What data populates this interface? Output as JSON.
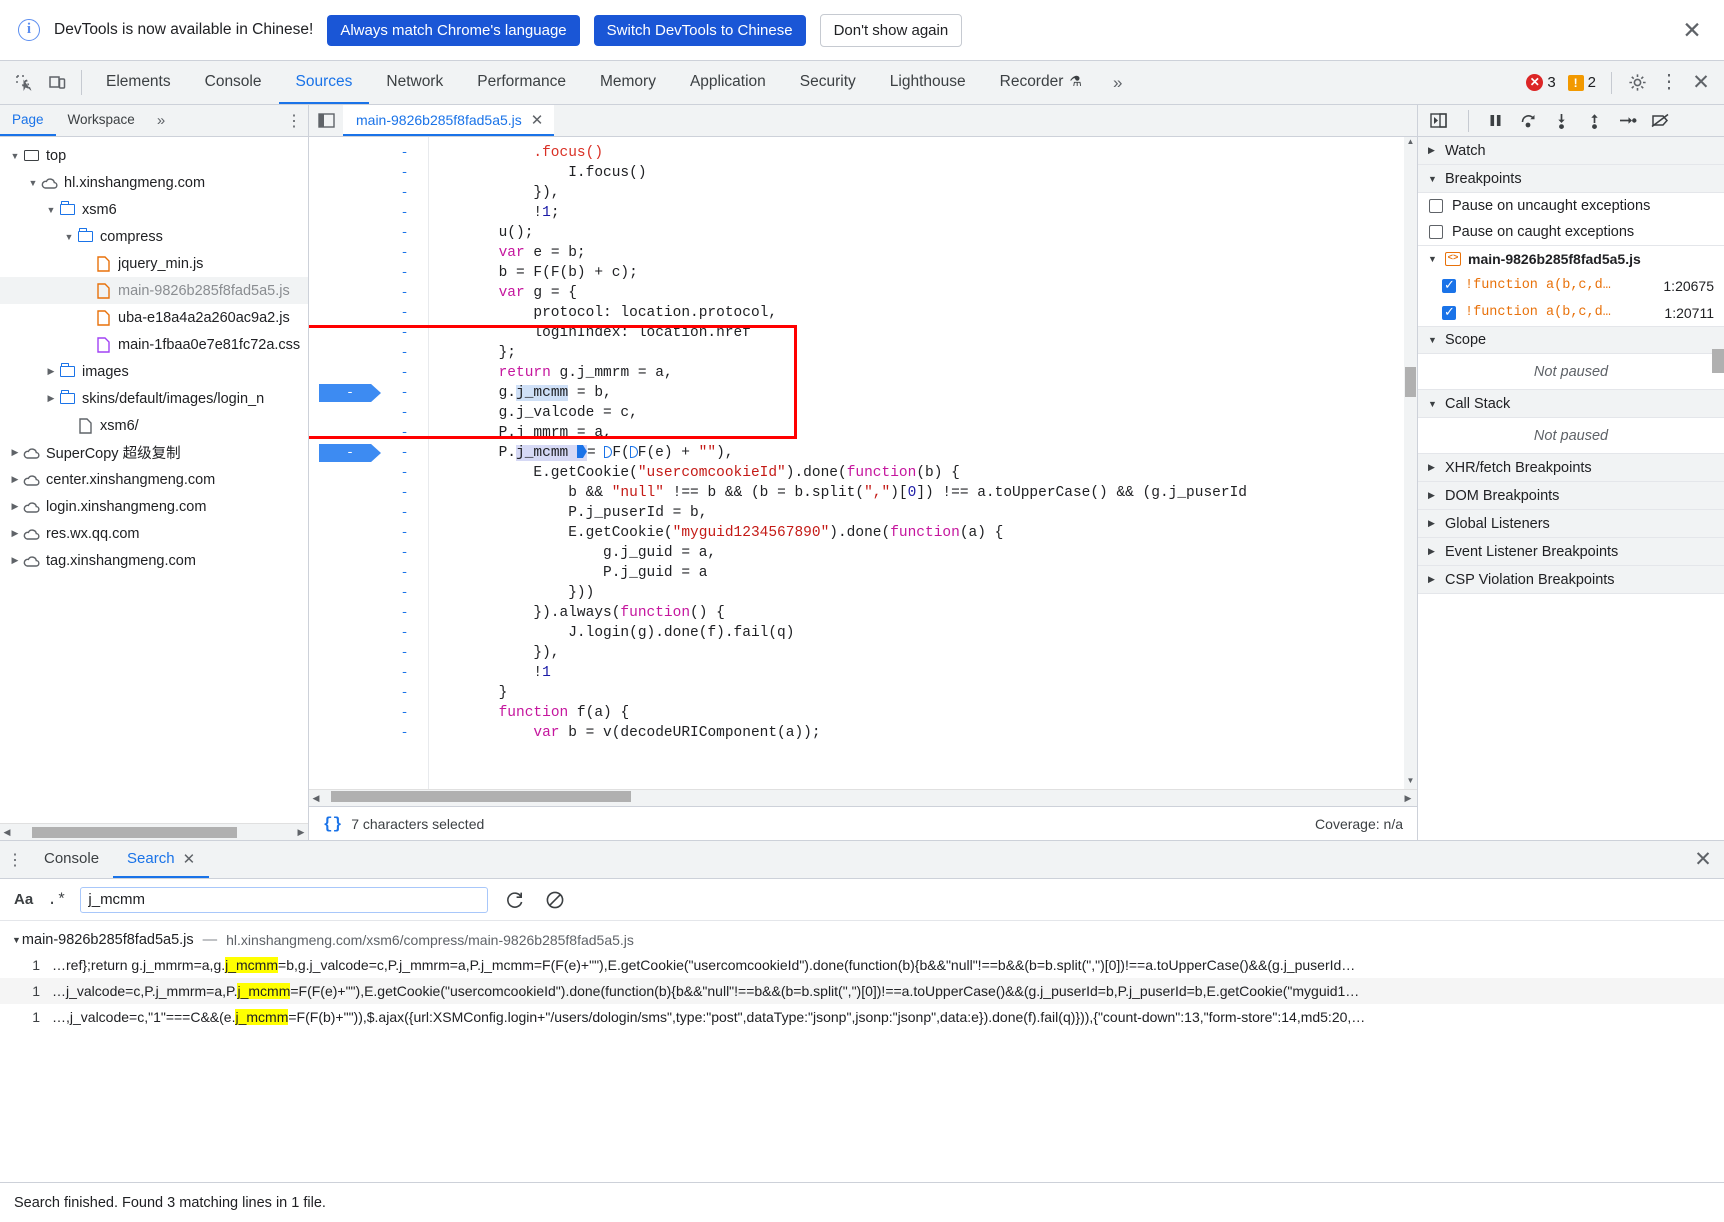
{
  "infobar": {
    "icon": "info-circle-icon",
    "message": "DevTools is now available in Chinese!",
    "primary_button": "Always match Chrome's language",
    "secondary_button": "Switch DevTools to Chinese",
    "tertiary_button": "Don't show again",
    "close_icon": "✕"
  },
  "main_tabs": {
    "inspect_icon": "inspect-element-icon",
    "device_icon": "device-toolbar-icon",
    "items": [
      {
        "label": "Elements",
        "active": false
      },
      {
        "label": "Console",
        "active": false
      },
      {
        "label": "Sources",
        "active": true
      },
      {
        "label": "Network",
        "active": false
      },
      {
        "label": "Performance",
        "active": false
      },
      {
        "label": "Memory",
        "active": false
      },
      {
        "label": "Application",
        "active": false
      },
      {
        "label": "Security",
        "active": false
      },
      {
        "label": "Lighthouse",
        "active": false
      },
      {
        "label": "Recorder",
        "active": false,
        "flask": "⚗"
      }
    ],
    "more_icon": "»",
    "error_count": "3",
    "warning_count": "2",
    "settings_icon": "gear-icon",
    "kebab_icon": "⋮",
    "close_icon": "✕"
  },
  "navigator": {
    "tabs": [
      {
        "label": "Page",
        "active": true
      },
      {
        "label": "Workspace",
        "active": false
      }
    ],
    "more_icon": "»",
    "kebab_icon": "⋮",
    "tree": [
      {
        "label": "top",
        "indent": 0,
        "arrow": "▼",
        "icon": "frame",
        "selected": false
      },
      {
        "label": "hl.xinshangmeng.com",
        "indent": 1,
        "arrow": "▼",
        "icon": "cloud",
        "selected": false
      },
      {
        "label": "xsm6",
        "indent": 2,
        "arrow": "▼",
        "icon": "folder",
        "selected": false
      },
      {
        "label": "compress",
        "indent": 3,
        "arrow": "▼",
        "icon": "folder",
        "selected": false
      },
      {
        "label": "jquery_min.js",
        "indent": 4,
        "arrow": "",
        "icon": "doc-orange",
        "selected": false
      },
      {
        "label": "main-9826b285f8fad5a5.js",
        "indent": 4,
        "arrow": "",
        "icon": "doc-orange",
        "selected": true
      },
      {
        "label": "uba-e18a4a2a260ac9a2.js",
        "indent": 4,
        "arrow": "",
        "icon": "doc-orange",
        "selected": false
      },
      {
        "label": "main-1fbaa0e7e81fc72a.css",
        "indent": 4,
        "arrow": "",
        "icon": "doc-purple",
        "selected": false
      },
      {
        "label": "images",
        "indent": 2,
        "arrow": "▶",
        "icon": "folder",
        "selected": false
      },
      {
        "label": "skins/default/images/login_n",
        "indent": 2,
        "arrow": "▶",
        "icon": "folder",
        "selected": false
      },
      {
        "label": "xsm6/",
        "indent": 3,
        "arrow": "",
        "icon": "doc-grey",
        "selected": false
      },
      {
        "label": "SuperCopy 超级复制",
        "indent": 0,
        "arrow": "▶",
        "icon": "cloud",
        "selected": false
      },
      {
        "label": "center.xinshangmeng.com",
        "indent": 0,
        "arrow": "▶",
        "icon": "cloud",
        "selected": false
      },
      {
        "label": "login.xinshangmeng.com",
        "indent": 0,
        "arrow": "▶",
        "icon": "cloud",
        "selected": false
      },
      {
        "label": "res.wx.qq.com",
        "indent": 0,
        "arrow": "▶",
        "icon": "cloud",
        "selected": false
      },
      {
        "label": "tag.xinshangmeng.com",
        "indent": 0,
        "arrow": "▶",
        "icon": "cloud",
        "selected": false
      }
    ]
  },
  "source": {
    "panel_toggle_icon": "show-navigator-icon",
    "tab_name": "main-9826b285f8fad5a5.js",
    "tab_close_icon": "✕",
    "gutter_marker": "-",
    "code_lines": [
      ".focus()",
      "I.focus()",
      "}),",
      "!1;",
      "u();",
      "var e = b;",
      "b = F(F(b) + c);",
      "var g = {",
      "protocol: location.protocol,",
      "loginIndex: location.href",
      "};",
      "return g.j_mmrm = a,",
      "g.j_mcmm = b,",
      "g.j_valcode = c,",
      "P.j_mmrm = a,",
      "P.j_mcmm = F(F(e) + \"\"),",
      "E.getCookie(\"usercomcookieId\").done(function(b) {",
      "b && \"null\" !== b && (b = b.split(\",\")[0]) !== a.toUpperCase() && (g.j_puserId",
      "P.j_puserId = b,",
      "E.getCookie(\"myguid1234567890\").done(function(a) {",
      "g.j_guid = a,",
      "P.j_guid = a",
      "}))",
      "}).always(function() {",
      "J.login(g).done(f).fail(q)",
      "}),",
      "!1",
      "}",
      "function f(a) {",
      "var b = v(decodeURIComponent(a));"
    ],
    "breakpoint_rows": [
      12,
      15
    ],
    "status": {
      "pretty_print_icon": "{}",
      "selection_text": "7 characters selected",
      "coverage_text": "Coverage: n/a"
    }
  },
  "debugger": {
    "toolbar_icons": [
      "resume-pause-icon",
      "step-over-icon",
      "step-into-icon",
      "step-out-icon",
      "step-icon",
      "deactivate-breakpoints-icon"
    ],
    "sections": {
      "watch": {
        "label": "Watch",
        "tri": "▶",
        "expanded": false
      },
      "breakpoints": {
        "label": "Breakpoints",
        "tri": "▼",
        "pause_uncaught": {
          "label": "Pause on uncaught exceptions",
          "checked": false
        },
        "pause_caught": {
          "label": "Pause on caught exceptions",
          "checked": false
        },
        "file": {
          "name": "main-9826b285f8fad5a5.js",
          "tri": "▼",
          "badge": "<>"
        },
        "items": [
          {
            "code": "!function a(b,c,d…",
            "location": "1:20675",
            "checked": true
          },
          {
            "code": "!function a(b,c,d…",
            "location": "1:20711",
            "checked": true
          }
        ]
      },
      "scope": {
        "label": "Scope",
        "tri": "▼",
        "empty_text": "Not paused"
      },
      "call_stack": {
        "label": "Call Stack",
        "tri": "▼",
        "empty_text": "Not paused"
      },
      "collapsed": [
        {
          "label": "XHR/fetch Breakpoints",
          "tri": "▶"
        },
        {
          "label": "DOM Breakpoints",
          "tri": "▶"
        },
        {
          "label": "Global Listeners",
          "tri": "▶"
        },
        {
          "label": "Event Listener Breakpoints",
          "tri": "▶"
        },
        {
          "label": "CSP Violation Breakpoints",
          "tri": "▶"
        }
      ]
    }
  },
  "drawer": {
    "kebab_icon": "⋮",
    "tabs": [
      {
        "label": "Console",
        "active": false,
        "closable": false
      },
      {
        "label": "Search",
        "active": true,
        "closable": true,
        "close_icon": "✕"
      }
    ],
    "close_icon": "✕",
    "search": {
      "match_case_label": "Aa",
      "regex_label": ".*",
      "value": "j_mcmm",
      "placeholder": "",
      "refresh_icon": "refresh-icon",
      "clear_icon": "clear-icon"
    },
    "results": {
      "file_tri": "▼",
      "file_name": "main-9826b285f8fad5a5.js",
      "file_dash": "—",
      "file_url": "hl.xinshangmeng.com/xsm6/compress/main-9826b285f8fad5a5.js",
      "lines": [
        {
          "number": "1",
          "pre": "…ref};return g.j_mmrm=a,g.",
          "match": "j_mcmm",
          "post": "=b,g.j_valcode=c,P.j_mmrm=a,P.j_mcmm=F(F(e)+\"\"),E.getCookie(\"usercomcookieId\").done(function(b){b&&\"null\"!==b&&(b=b.split(\",\")[0])!==a.toUpperCase()&&(g.j_puserId…"
        },
        {
          "number": "1",
          "pre": "…j_valcode=c,P.j_mmrm=a,P.",
          "match": "j_mcmm",
          "post": "=F(F(e)+\"\"),E.getCookie(\"usercomcookieId\").done(function(b){b&&\"null\"!==b&&(b=b.split(\",\")[0])!==a.toUpperCase()&&(g.j_puserId=b,P.j_puserId=b,E.getCookie(\"myguid1…"
        },
        {
          "number": "1",
          "pre": "…,j_valcode=c,\"1\"===C&&(e.",
          "match": "j_mcmm",
          "post": "=F(F(b)+\"\")),$.ajax({url:XSMConfig.login+\"/users/dologin/sms\",type:\"post\",dataType:\"jsonp\",jsonp:\"jsonp\",data:e}).done(f).fail(q)})),{\"count-down\":13,\"form-store\":14,md5:20,…"
        }
      ]
    },
    "status_text": "Search finished.  Found 3 matching lines in 1 file."
  }
}
